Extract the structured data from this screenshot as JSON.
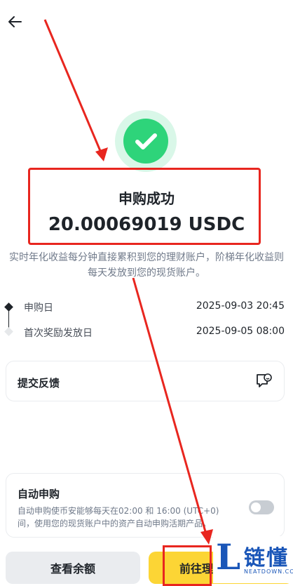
{
  "header": {
    "back_icon": "arrow-left-icon"
  },
  "status": {
    "icon": "check-icon",
    "accent": "#2ed47a"
  },
  "result": {
    "title": "申购成功",
    "amount": "20.00069019 USDC",
    "description": "实时年化收益每分钟直接累积到您的理财账户，阶梯年化收益则每天发放到您的现货账户。"
  },
  "timeline": [
    {
      "label": "申购日",
      "value": "2025-09-03 20:45"
    },
    {
      "label": "首次奖励发放日",
      "value": "2025-09-05 08:00"
    }
  ],
  "feedback": {
    "label": "提交反馈",
    "icon": "feedback-smile-icon"
  },
  "auto_subscribe": {
    "title": "自动申购",
    "description": "自动申购使币安能够每天在02:00 和 16:00 (UTC+0)间，使用您的现货账户中的资产自动申购活期产品。",
    "enabled": false
  },
  "actions": {
    "view_balance": "查看余额",
    "go_to": "前往理"
  },
  "watermark": {
    "cn": "链懂",
    "en": "NEATDOWN.COM",
    "letter": "L"
  },
  "colors": {
    "highlight": "#e8261f",
    "primary_button": "#fcd535"
  }
}
